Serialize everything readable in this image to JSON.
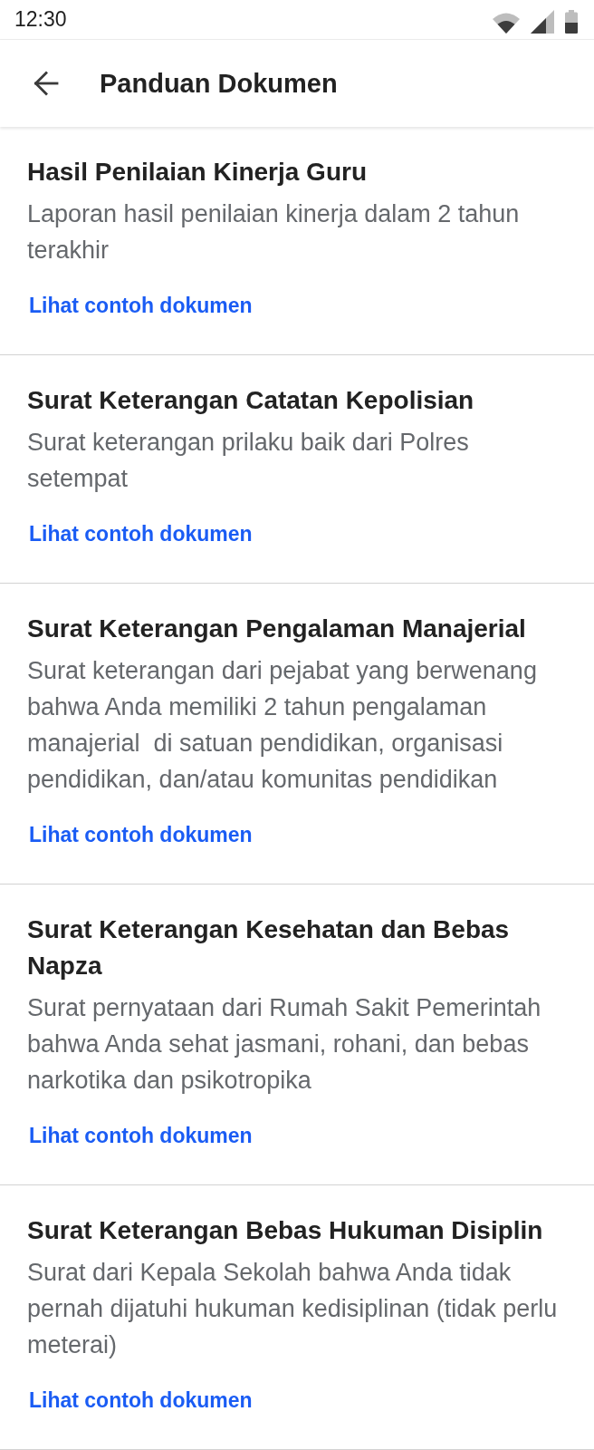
{
  "status_bar": {
    "time": "12:30"
  },
  "app_bar": {
    "title": "Panduan Dokumen"
  },
  "documents": [
    {
      "title": "Hasil Penilaian Kinerja Guru",
      "description": "Laporan hasil penilaian kinerja dalam 2 tahun terakhir",
      "link": "Lihat contoh dokumen"
    },
    {
      "title": "Surat Keterangan Catatan Kepolisian",
      "description": "Surat keterangan prilaku baik dari Polres setempat",
      "link": "Lihat contoh dokumen"
    },
    {
      "title": "Surat Keterangan Pengalaman Manajerial",
      "description": "Surat keterangan dari pejabat yang berwenang bahwa Anda memiliki 2 tahun pengalaman manajerial  di satuan pendidikan, organisasi pendidikan, dan/atau komunitas pendidikan",
      "link": "Lihat contoh dokumen"
    },
    {
      "title": "Surat Keterangan Kesehatan dan Bebas Napza",
      "description": "Surat pernyataan dari Rumah Sakit Pemerintah bahwa Anda sehat jasmani, rohani, dan bebas narkotika dan psikotropika",
      "link": "Lihat contoh dokumen"
    },
    {
      "title": "Surat Keterangan Bebas Hukuman Disiplin",
      "description": "Surat dari Kepala Sekolah bahwa Anda tidak pernah dijatuhi hukuman kedisiplinan (tidak perlu meterai)",
      "link": "Lihat contoh dokumen"
    }
  ]
}
